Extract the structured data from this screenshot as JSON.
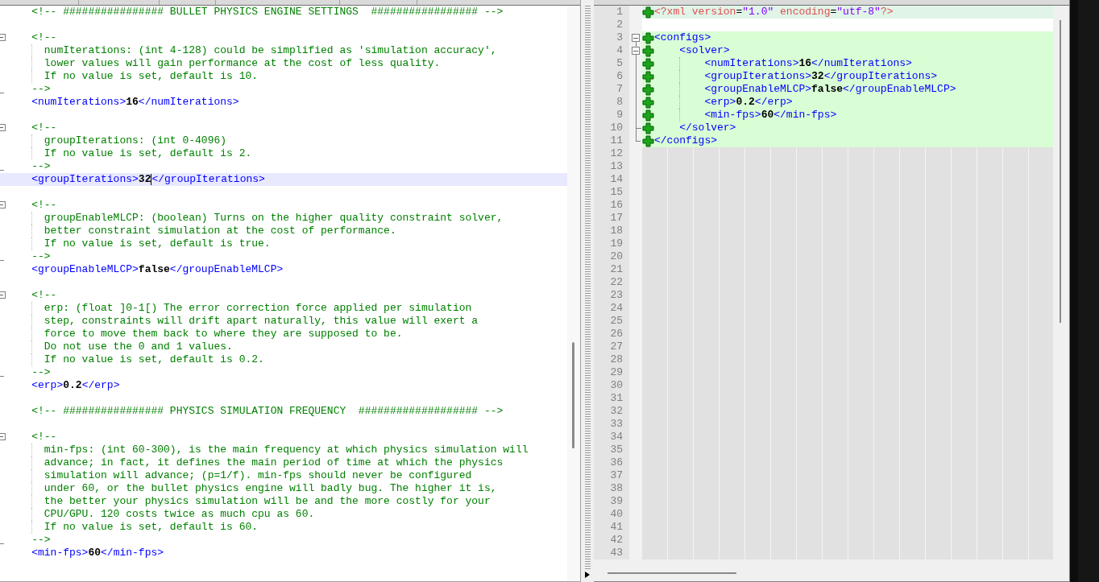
{
  "left": {
    "lines": [
      {
        "kind": "comment",
        "current": false,
        "segs": [
          {
            "t": "    <!-- ################ BULLET PHYSICS ENGINE SETTINGS  ################# -->",
            "kind": "comment"
          }
        ]
      },
      {
        "kind": "blank",
        "current": false
      },
      {
        "kind": "comment_open",
        "current": false,
        "segs": [
          {
            "t": "    <!--",
            "kind": "comment"
          }
        ]
      },
      {
        "kind": "comment_body",
        "current": false,
        "segs": [
          {
            "t": "      numIterations: (int 4-128) could be simplified as 'simulation accuracy',",
            "kind": "comment"
          }
        ]
      },
      {
        "kind": "comment_body",
        "current": false,
        "segs": [
          {
            "t": "      lower values will gain performance at the cost of less quality.",
            "kind": "comment"
          }
        ]
      },
      {
        "kind": "comment_body",
        "current": false,
        "segs": [
          {
            "t": "      If no value is set, default is 10.",
            "kind": "comment"
          }
        ]
      },
      {
        "kind": "comment_close",
        "current": false,
        "segs": [
          {
            "t": "    -->",
            "kind": "comment"
          }
        ]
      },
      {
        "kind": "element",
        "current": false,
        "segs": [
          {
            "t": "    <numIterations>",
            "kind": "tag"
          },
          {
            "t": "16",
            "kind": "value"
          },
          {
            "t": "</numIterations>",
            "kind": "tag"
          }
        ]
      },
      {
        "kind": "blank",
        "current": false
      },
      {
        "kind": "comment_open",
        "current": false,
        "segs": [
          {
            "t": "    <!--",
            "kind": "comment"
          }
        ]
      },
      {
        "kind": "comment_body",
        "current": false,
        "segs": [
          {
            "t": "      groupIterations: (int 0-4096)",
            "kind": "comment"
          }
        ]
      },
      {
        "kind": "comment_body",
        "current": false,
        "segs": [
          {
            "t": "      If no value is set, default is 2.",
            "kind": "comment"
          }
        ]
      },
      {
        "kind": "comment_close",
        "current": false,
        "segs": [
          {
            "t": "    -->",
            "kind": "comment"
          }
        ]
      },
      {
        "kind": "element",
        "current": true,
        "segs": [
          {
            "t": "    <groupIterations>",
            "kind": "tag"
          },
          {
            "t": "32",
            "kind": "value"
          },
          {
            "t": "</groupIterations>",
            "kind": "tag"
          }
        ]
      },
      {
        "kind": "blank",
        "current": false
      },
      {
        "kind": "comment_open",
        "current": false,
        "segs": [
          {
            "t": "    <!--",
            "kind": "comment"
          }
        ]
      },
      {
        "kind": "comment_body",
        "current": false,
        "segs": [
          {
            "t": "      groupEnableMLCP: (boolean) Turns on the higher quality constraint solver,",
            "kind": "comment"
          }
        ]
      },
      {
        "kind": "comment_body",
        "current": false,
        "segs": [
          {
            "t": "      better constraint simulation at the cost of performance.",
            "kind": "comment"
          }
        ]
      },
      {
        "kind": "comment_body",
        "current": false,
        "segs": [
          {
            "t": "      If no value is set, default is true.",
            "kind": "comment"
          }
        ]
      },
      {
        "kind": "comment_close",
        "current": false,
        "segs": [
          {
            "t": "    -->",
            "kind": "comment"
          }
        ]
      },
      {
        "kind": "element",
        "current": false,
        "segs": [
          {
            "t": "    <groupEnableMLCP>",
            "kind": "tag"
          },
          {
            "t": "false",
            "kind": "value"
          },
          {
            "t": "</groupEnableMLCP>",
            "kind": "tag"
          }
        ]
      },
      {
        "kind": "blank",
        "current": false
      },
      {
        "kind": "comment_open",
        "current": false,
        "segs": [
          {
            "t": "    <!--",
            "kind": "comment"
          }
        ]
      },
      {
        "kind": "comment_body",
        "current": false,
        "segs": [
          {
            "t": "      erp: (float ]0-1[) The error correction force applied per simulation",
            "kind": "comment"
          }
        ]
      },
      {
        "kind": "comment_body",
        "current": false,
        "segs": [
          {
            "t": "      step, constraints will drift apart naturally, this value will exert a",
            "kind": "comment"
          }
        ]
      },
      {
        "kind": "comment_body",
        "current": false,
        "segs": [
          {
            "t": "      force to move them back to where they are supposed to be.",
            "kind": "comment"
          }
        ]
      },
      {
        "kind": "comment_body",
        "current": false,
        "segs": [
          {
            "t": "      Do not use the 0 and 1 values.",
            "kind": "comment"
          }
        ]
      },
      {
        "kind": "comment_body",
        "current": false,
        "segs": [
          {
            "t": "      If no value is set, default is 0.2.",
            "kind": "comment"
          }
        ]
      },
      {
        "kind": "comment_close",
        "current": false,
        "segs": [
          {
            "t": "    -->",
            "kind": "comment"
          }
        ]
      },
      {
        "kind": "element",
        "current": false,
        "segs": [
          {
            "t": "    <erp>",
            "kind": "tag"
          },
          {
            "t": "0.2",
            "kind": "value"
          },
          {
            "t": "</erp>",
            "kind": "tag"
          }
        ]
      },
      {
        "kind": "blank",
        "current": false
      },
      {
        "kind": "comment",
        "current": false,
        "segs": [
          {
            "t": "    <!-- ################ PHYSICS SIMULATION FREQUENCY  ################### -->",
            "kind": "comment"
          }
        ]
      },
      {
        "kind": "blank",
        "current": false
      },
      {
        "kind": "comment_open",
        "current": false,
        "segs": [
          {
            "t": "    <!--",
            "kind": "comment"
          }
        ]
      },
      {
        "kind": "comment_body",
        "current": false,
        "segs": [
          {
            "t": "      min-fps: (int 60-300), is the main frequency at which physics simulation will",
            "kind": "comment"
          }
        ]
      },
      {
        "kind": "comment_body",
        "current": false,
        "segs": [
          {
            "t": "      advance; in fact, it defines the main period of time at which the physics",
            "kind": "comment"
          }
        ]
      },
      {
        "kind": "comment_body",
        "current": false,
        "segs": [
          {
            "t": "      simulation will advance; (p=1/f). min-fps should never be configured",
            "kind": "comment"
          }
        ]
      },
      {
        "kind": "comment_body",
        "current": false,
        "segs": [
          {
            "t": "      under 60, or the bullet physics engine will badly bug. The higher it is,",
            "kind": "comment"
          }
        ]
      },
      {
        "kind": "comment_body",
        "current": false,
        "segs": [
          {
            "t": "      the better your physics simulation will be and the more costly for your",
            "kind": "comment"
          }
        ]
      },
      {
        "kind": "comment_body",
        "current": false,
        "segs": [
          {
            "t": "      CPU/GPU. 120 costs twice as much cpu as 60.",
            "kind": "comment"
          }
        ]
      },
      {
        "kind": "comment_body",
        "current": false,
        "segs": [
          {
            "t": "      If no value is set, default is 60.",
            "kind": "comment"
          }
        ]
      },
      {
        "kind": "comment_close",
        "current": false,
        "segs": [
          {
            "t": "    -->",
            "kind": "comment"
          }
        ]
      },
      {
        "kind": "element",
        "current": false,
        "segs": [
          {
            "t": "    <min-fps>",
            "kind": "tag"
          },
          {
            "t": "60",
            "kind": "value"
          },
          {
            "t": "</min-fps>",
            "kind": "tag"
          }
        ]
      },
      {
        "kind": "blank",
        "current": false
      }
    ]
  },
  "right": {
    "lines": [
      {
        "number": "1",
        "kind": "changed",
        "segs": [
          {
            "t": "<?xml",
            "kind": "pi"
          },
          {
            "t": " version",
            "kind": "attr"
          },
          {
            "t": "=",
            "kind": "eq"
          },
          {
            "t": "\"1.0\"",
            "kind": "string"
          },
          {
            "t": " encoding",
            "kind": "attr"
          },
          {
            "t": "=",
            "kind": "eq"
          },
          {
            "t": "\"utf-8\"",
            "kind": "string"
          },
          {
            "t": "?>",
            "kind": "pi"
          }
        ]
      },
      {
        "number": "2",
        "kind": "same"
      },
      {
        "number": "3",
        "kind": "added",
        "fold": {
          "kind": "open"
        },
        "segs": [
          {
            "t": "<configs>",
            "kind": "tag"
          }
        ]
      },
      {
        "number": "4",
        "kind": "added",
        "fold": {
          "kind": "open_nested"
        },
        "segs": [
          {
            "t": "    <solver>",
            "kind": "tag"
          }
        ]
      },
      {
        "number": "5",
        "kind": "added",
        "fold": {
          "kind": "inside"
        },
        "segs": [
          {
            "t": "        <numIterations>",
            "kind": "tag"
          },
          {
            "t": "16",
            "kind": "value"
          },
          {
            "t": "</numIterations>",
            "kind": "tag"
          }
        ]
      },
      {
        "number": "6",
        "kind": "added",
        "fold": {
          "kind": "inside"
        },
        "segs": [
          {
            "t": "        <groupIterations>",
            "kind": "tag"
          },
          {
            "t": "32",
            "kind": "value"
          },
          {
            "t": "</groupIterations>",
            "kind": "tag"
          }
        ]
      },
      {
        "number": "7",
        "kind": "added",
        "fold": {
          "kind": "inside"
        },
        "segs": [
          {
            "t": "        <groupEnableMLCP>",
            "kind": "tag"
          },
          {
            "t": "false",
            "kind": "value"
          },
          {
            "t": "</groupEnableMLCP>",
            "kind": "tag"
          }
        ]
      },
      {
        "number": "8",
        "kind": "added",
        "fold": {
          "kind": "inside"
        },
        "segs": [
          {
            "t": "        <erp>",
            "kind": "tag"
          },
          {
            "t": "0.2",
            "kind": "value"
          },
          {
            "t": "</erp>",
            "kind": "tag"
          }
        ]
      },
      {
        "number": "9",
        "kind": "added",
        "fold": {
          "kind": "inside"
        },
        "segs": [
          {
            "t": "        <min-fps>",
            "kind": "tag"
          },
          {
            "t": "60",
            "kind": "value"
          },
          {
            "t": "</min-fps>",
            "kind": "tag"
          }
        ]
      },
      {
        "number": "10",
        "kind": "added",
        "fold": {
          "kind": "end_nested"
        },
        "segs": [
          {
            "t": "    </solver>",
            "kind": "tag"
          }
        ]
      },
      {
        "number": "11",
        "kind": "added",
        "fold": {
          "kind": "end"
        },
        "segs": [
          {
            "t": "</configs>",
            "kind": "tag"
          }
        ]
      },
      {
        "number": "12",
        "kind": "padding"
      },
      {
        "number": "13",
        "kind": "padding"
      },
      {
        "number": "14",
        "kind": "padding"
      },
      {
        "number": "15",
        "kind": "padding"
      },
      {
        "number": "16",
        "kind": "padding"
      },
      {
        "number": "17",
        "kind": "padding"
      },
      {
        "number": "18",
        "kind": "padding"
      },
      {
        "number": "19",
        "kind": "padding"
      },
      {
        "number": "20",
        "kind": "padding"
      },
      {
        "number": "21",
        "kind": "padding"
      },
      {
        "number": "22",
        "kind": "padding"
      },
      {
        "number": "23",
        "kind": "padding"
      },
      {
        "number": "24",
        "kind": "padding"
      },
      {
        "number": "25",
        "kind": "padding"
      },
      {
        "number": "26",
        "kind": "padding"
      },
      {
        "number": "27",
        "kind": "padding"
      },
      {
        "number": "28",
        "kind": "padding"
      },
      {
        "number": "29",
        "kind": "padding"
      },
      {
        "number": "30",
        "kind": "padding"
      },
      {
        "number": "31",
        "kind": "padding"
      },
      {
        "number": "32",
        "kind": "padding"
      },
      {
        "number": "33",
        "kind": "padding"
      },
      {
        "number": "34",
        "kind": "padding"
      },
      {
        "number": "35",
        "kind": "padding"
      },
      {
        "number": "36",
        "kind": "padding"
      },
      {
        "number": "37",
        "kind": "padding"
      },
      {
        "number": "38",
        "kind": "padding"
      },
      {
        "number": "39",
        "kind": "padding"
      },
      {
        "number": "40",
        "kind": "padding"
      },
      {
        "number": "41",
        "kind": "padding"
      },
      {
        "number": "42",
        "kind": "padding"
      },
      {
        "number": "43",
        "kind": "padding"
      }
    ]
  }
}
